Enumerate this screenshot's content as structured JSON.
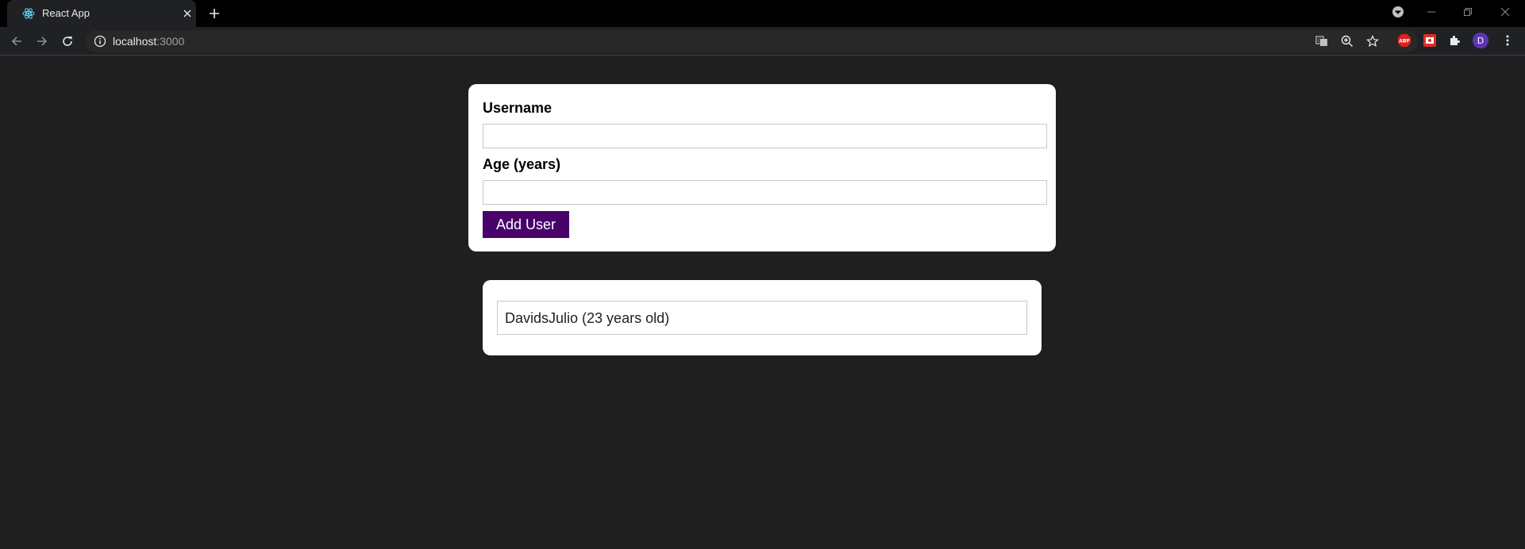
{
  "browser": {
    "tab_title": "React App",
    "url_host": "localhost",
    "url_port": ":3000",
    "profile_initial": "D",
    "abp_label": "ABP",
    "icons": {
      "favicon": "react-logo-icon",
      "close": "close-icon",
      "new_tab": "plus-icon",
      "back": "arrow-left-icon",
      "forward": "arrow-right-icon",
      "reload": "reload-icon",
      "info": "info-icon",
      "translate": "translate-icon",
      "zoom": "zoom-icon",
      "bookmark": "star-icon",
      "extensions": "puzzle-icon",
      "menu": "kebab-menu-icon"
    }
  },
  "form": {
    "username_label": "Username",
    "username_value": "",
    "age_label": "Age (years)",
    "age_value": "",
    "submit_label": "Add User"
  },
  "users": [
    {
      "text": "DavidsJulio (23 years old)"
    }
  ],
  "colors": {
    "page_bg": "#1f1f1f",
    "button_bg": "#4a026b",
    "card_bg": "#ffffff"
  }
}
